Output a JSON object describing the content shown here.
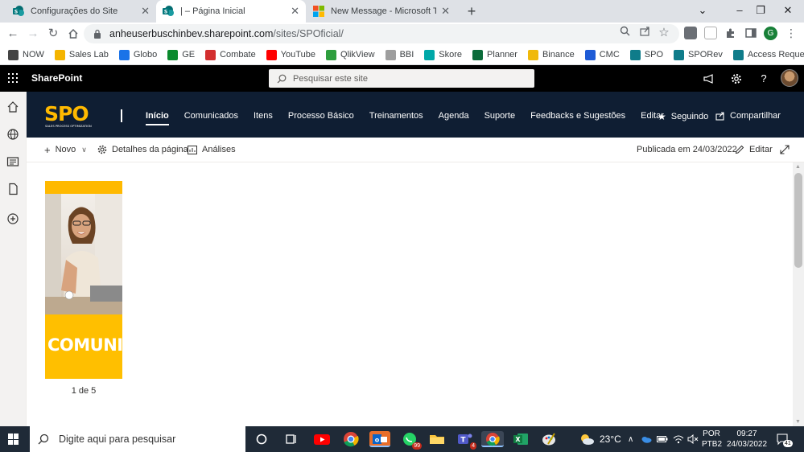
{
  "browser": {
    "tabs": [
      {
        "title": "Configurações do Site",
        "active": false
      },
      {
        "title": "| – Página Inicial",
        "active": true
      },
      {
        "title": "New Message - Microsoft Tech C",
        "active": false
      }
    ],
    "url_host": "anheuserbuschinbev.sharepoint.com",
    "url_path": "/sites/SPOficial/",
    "profile_initial": "G"
  },
  "bookmarks": [
    {
      "label": "NOW",
      "color": "#444444"
    },
    {
      "label": "Sales Lab",
      "color": "#f4b400"
    },
    {
      "label": "Globo",
      "color": "#1a73e8"
    },
    {
      "label": "GE",
      "color": "#0b8a2e"
    },
    {
      "label": "Combate",
      "color": "#d32f2f"
    },
    {
      "label": "YouTube",
      "color": "#ff0000"
    },
    {
      "label": "QlikView",
      "color": "#2e9e3e"
    },
    {
      "label": "BBI",
      "color": "#9e9e9e"
    },
    {
      "label": "Skore",
      "color": "#00a8a8"
    },
    {
      "label": "Planner",
      "color": "#0b6b3a"
    },
    {
      "label": "Binance",
      "color": "#f0b90b"
    },
    {
      "label": "CMC",
      "color": "#1e5bd6"
    },
    {
      "label": "SPO",
      "color": "#0f7c8a"
    },
    {
      "label": "SPORev",
      "color": "#0f7c8a"
    },
    {
      "label": "Access Request",
      "color": "#0f7c8a"
    }
  ],
  "suitebar": {
    "brand": "SharePoint",
    "search_placeholder": "Pesquisar este site"
  },
  "site": {
    "logo_text": "SPO",
    "logo_subtext": "SALES PROCESS OPTIMIZATION",
    "nav": [
      {
        "label": "Início",
        "selected": true
      },
      {
        "label": "Comunicados",
        "selected": false
      },
      {
        "label": "Itens",
        "selected": false
      },
      {
        "label": "Processo Básico",
        "selected": false
      },
      {
        "label": "Treinamentos",
        "selected": false
      },
      {
        "label": "Agenda",
        "selected": false
      },
      {
        "label": "Suporte",
        "selected": false
      },
      {
        "label": "Feedbacks e Sugestões",
        "selected": false
      },
      {
        "label": "Editar",
        "selected": false
      }
    ],
    "follow_label": "Seguindo",
    "share_label": "Compartilhar",
    "header_bg": "#0f1e33",
    "accent": "#ffb900"
  },
  "command_bar": {
    "new_label": "Novo",
    "details_label": "Detalhes da página",
    "analytics_label": "Análises",
    "published": "Publicada em 24/03/2022",
    "edit_label": "Editar"
  },
  "carousel": {
    "banner_text": "COMUNICA",
    "pager": "1 de 5"
  },
  "taskbar": {
    "search_placeholder": "Digite aqui para pesquisar",
    "whatsapp_badge": "99",
    "teams_badge": "4",
    "temperature": "23°C",
    "lang": "POR",
    "layout": "PTB2",
    "time": "09:27",
    "date": "24/03/2022",
    "notifications": "41"
  }
}
